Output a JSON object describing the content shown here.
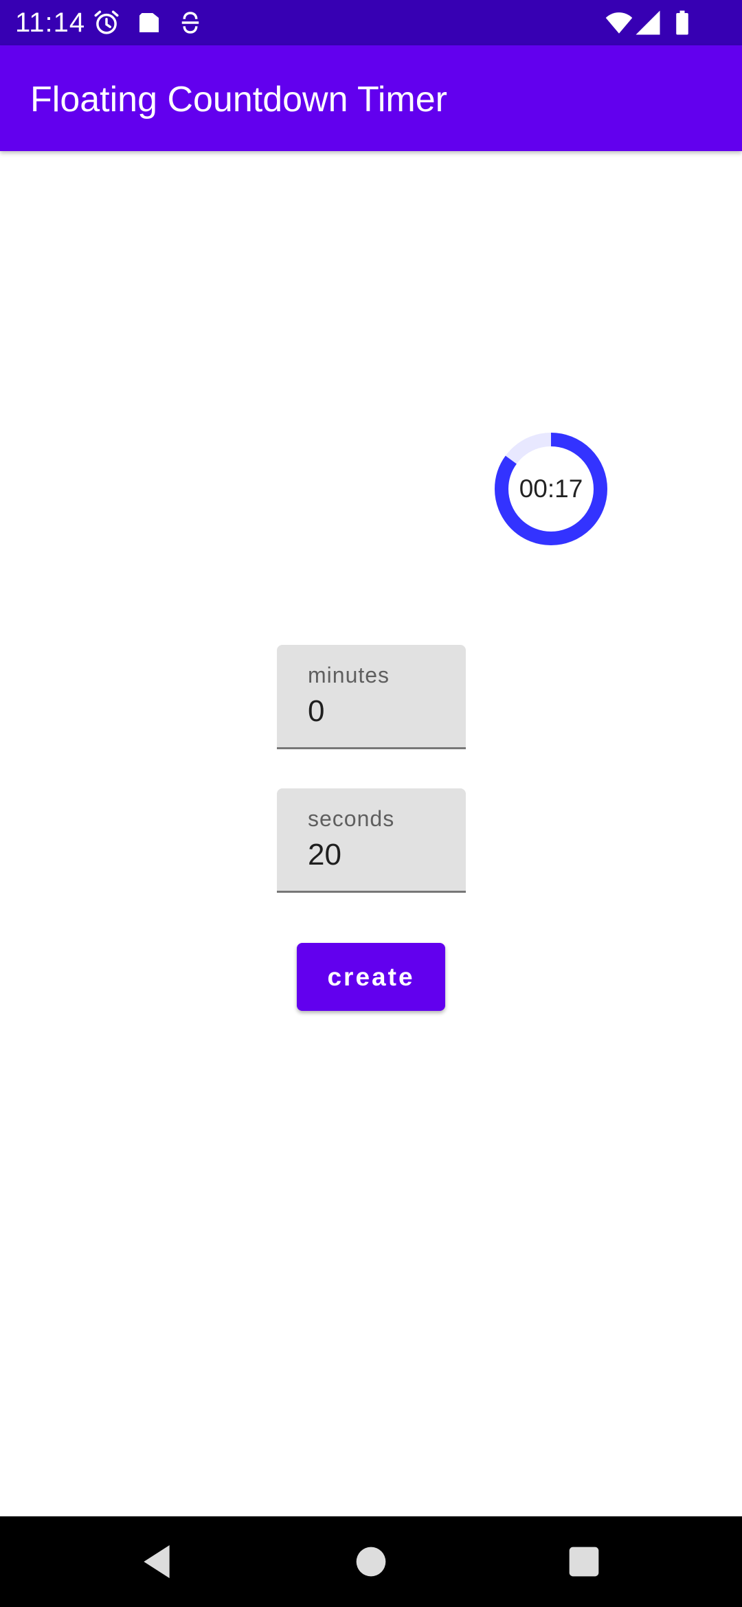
{
  "status_bar": {
    "time": "11:14",
    "icons_left": [
      "alarm-icon",
      "sd-card-icon",
      "vpn-icon"
    ],
    "icons_right": [
      "wifi-icon",
      "signal-icon",
      "battery-icon"
    ]
  },
  "app_bar": {
    "title": "Floating Countdown Timer"
  },
  "timer": {
    "display": "00:17",
    "progress_remaining_fraction": 0.85,
    "ring_color": "#3333ff",
    "track_color": "#e8e8ff"
  },
  "form": {
    "minutes": {
      "label": "minutes",
      "value": "0"
    },
    "seconds": {
      "label": "seconds",
      "value": "20"
    },
    "create_label": "create"
  },
  "nav_bar": {
    "buttons": [
      "back-icon",
      "home-icon",
      "recents-icon"
    ]
  },
  "colors": {
    "status_bar": "#3700b3",
    "primary": "#6200ee"
  }
}
